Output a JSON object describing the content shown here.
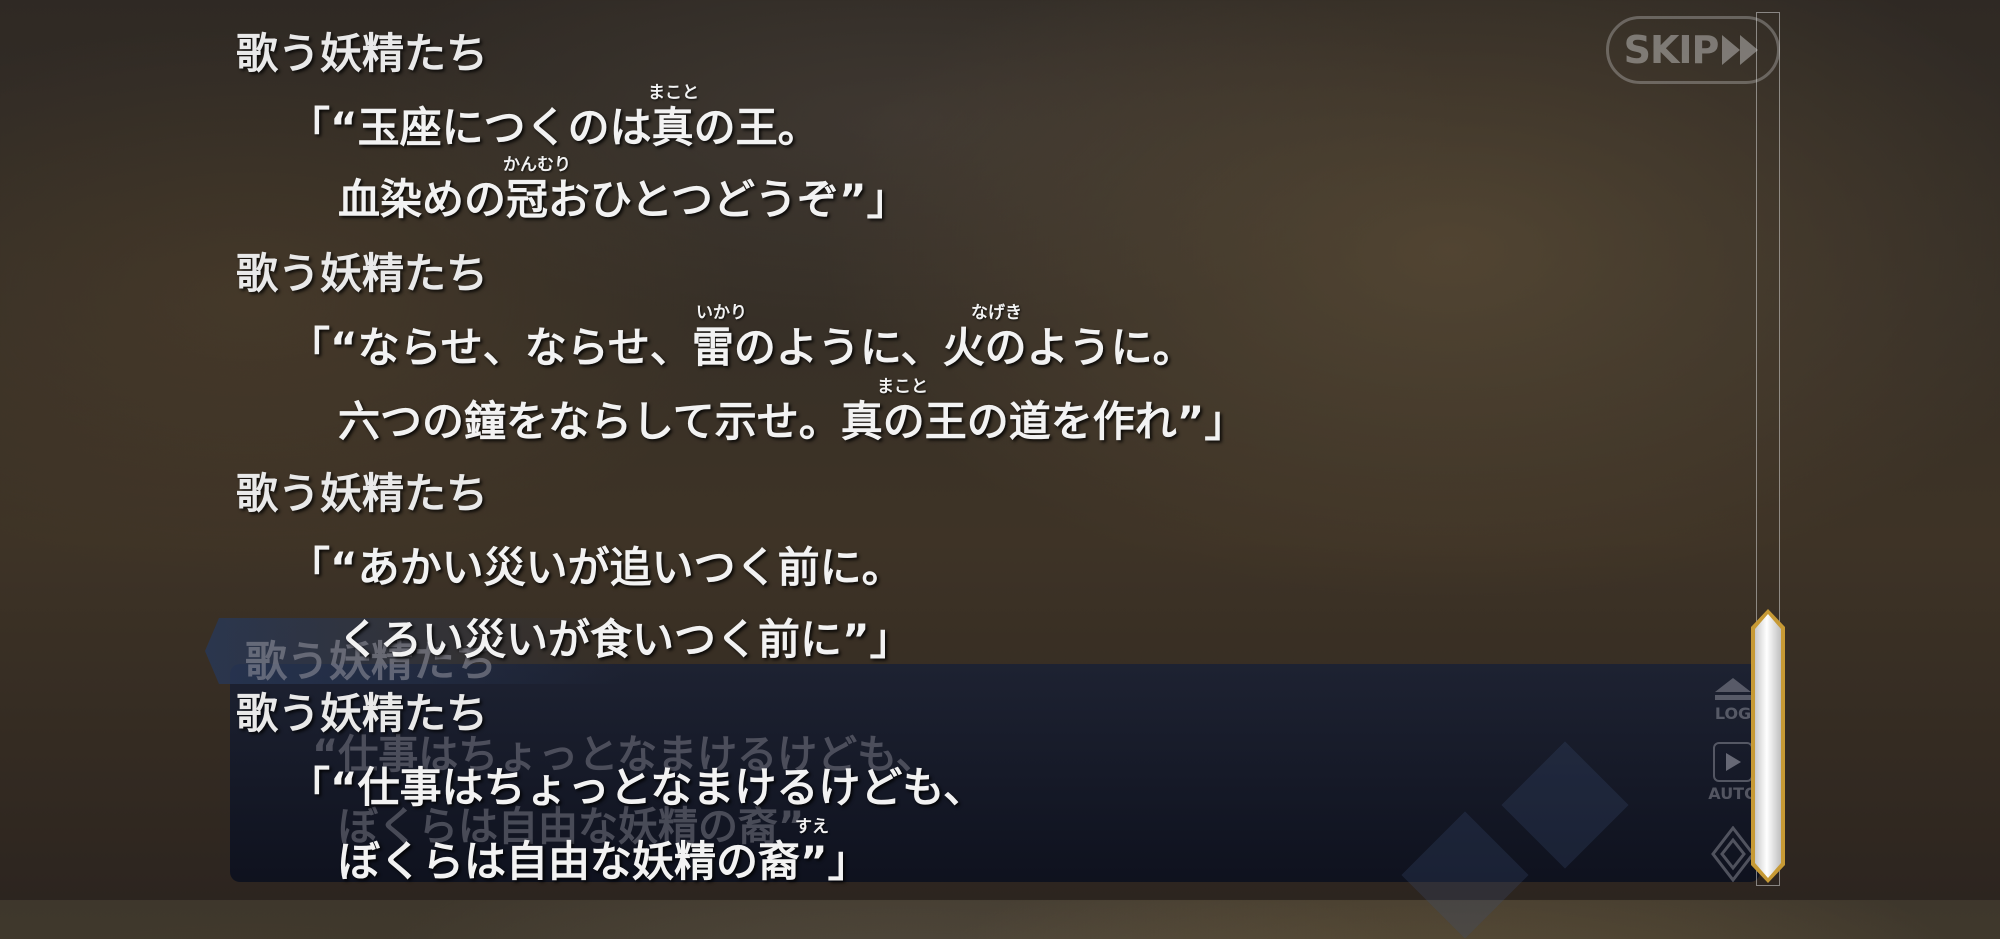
{
  "skip_button": {
    "label": "SKIP"
  },
  "log_entries": [
    {
      "speaker": "歌う妖精たち",
      "lines": [
        "「“玉座につくのは真の王。",
        "血染めの冠おひとつどうぞ”」"
      ],
      "ruby": [
        "まこと",
        "かんむり"
      ]
    },
    {
      "speaker": "歌う妖精たち",
      "lines": [
        "「“ならせ、ならせ、雷のように、火のように。",
        "六つの鐘をならして示せ。真の王の道を作れ”」"
      ],
      "ruby": [
        "いかり",
        "なげき",
        "まこと"
      ]
    },
    {
      "speaker": "歌う妖精たち",
      "lines": [
        "「“あかい災いが追いつく前に。",
        "くろい災いが食いつく前に”」"
      ]
    },
    {
      "speaker": "歌う妖精たち",
      "lines": [
        "「“仕事はちょっとなまけるけども、",
        "ぼくらは自由な妖精の裔”」"
      ],
      "ruby": [
        "すえ"
      ]
    }
  ],
  "background_dialog": {
    "speaker": "歌う妖精たち",
    "lines": [
      "“仕事はちょっとなまけるけども、",
      "ぼくらは自由な妖精の裔”"
    ]
  },
  "side_controls": {
    "log_label": "LOG",
    "auto_label": "AUTO"
  },
  "scroll": {
    "position": 1.0
  }
}
